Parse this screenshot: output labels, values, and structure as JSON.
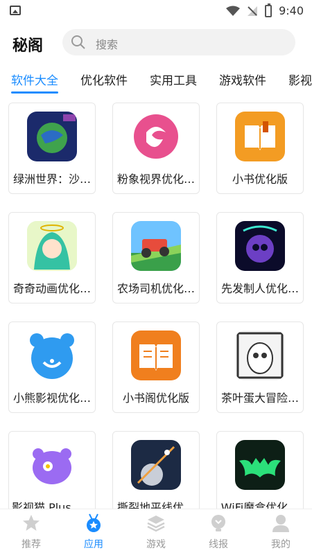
{
  "status": {
    "time": "9:40"
  },
  "header": {
    "title": "秘阁",
    "search_placeholder": "搜索"
  },
  "tabs": [
    {
      "label": "软件大全",
      "active": true
    },
    {
      "label": "优化软件"
    },
    {
      "label": "实用工具"
    },
    {
      "label": "游戏软件"
    },
    {
      "label": "影视"
    }
  ],
  "apps": [
    {
      "label": "绿洲世界：沙…",
      "icon": "world-icon"
    },
    {
      "label": "粉象视界优化…",
      "icon": "pink-logo-icon"
    },
    {
      "label": "小书优化版",
      "icon": "book-icon"
    },
    {
      "label": "奇奇动画优化…",
      "icon": "anime-girl-icon"
    },
    {
      "label": "农场司机优化…",
      "icon": "truck-icon"
    },
    {
      "label": "先发制人优化…",
      "icon": "skull-icon"
    },
    {
      "label": "小熊影视优化…",
      "icon": "bear-icon"
    },
    {
      "label": "小书阁优化版",
      "icon": "book-icon"
    },
    {
      "label": "茶叶蛋大冒险…",
      "icon": "egg-cartoon-icon"
    },
    {
      "label": "影视猫 Plus优…",
      "icon": "cat-icon"
    },
    {
      "label": "撕裂地平线优…",
      "icon": "space-icon"
    },
    {
      "label": "WiFi魔盒优化…",
      "icon": "batman-icon"
    }
  ],
  "nav": [
    {
      "label": "推荐",
      "icon": "star-icon",
      "active": false
    },
    {
      "label": "应用",
      "icon": "medal-icon",
      "active": true
    },
    {
      "label": "游戏",
      "icon": "layers-icon",
      "active": false
    },
    {
      "label": "线报",
      "icon": "bulb-icon",
      "active": false
    },
    {
      "label": "我的",
      "icon": "user-icon",
      "active": false
    }
  ],
  "colors": {
    "accent": "#1a8cff",
    "inactive": "#999999"
  }
}
